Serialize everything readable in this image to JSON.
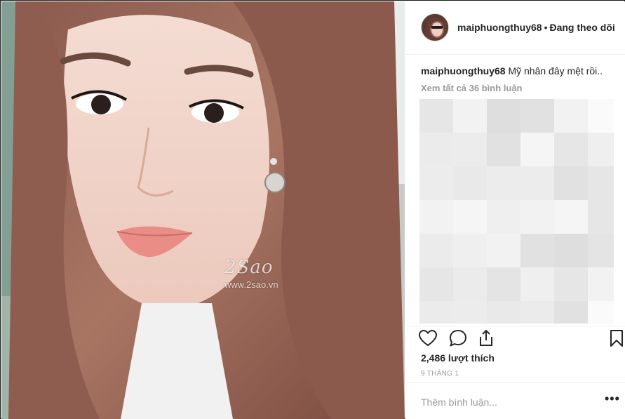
{
  "post": {
    "username": "maiphuongthuy68",
    "separator": "•",
    "follow_status": "Đang theo dõi",
    "caption_user": "maiphuongthuy68",
    "caption_text": "Mỹ nhân đây mệt rồi..",
    "view_all_comments": "Xem tất cả 36 bình luận",
    "likes": "2,486 lượt thích",
    "date": "9 THÁNG 1",
    "comment_placeholder": "Thêm bình luận...",
    "more_label": "•••"
  },
  "photo": {
    "watermark_logo": "2Sao",
    "watermark_url": "www.2sao.vn"
  },
  "icons": {
    "like": "heart-icon",
    "comment": "comment-icon",
    "share": "share-icon",
    "save": "bookmark-icon"
  },
  "colors": {
    "text": "#262626",
    "muted": "#999999",
    "divider": "#efefef"
  }
}
